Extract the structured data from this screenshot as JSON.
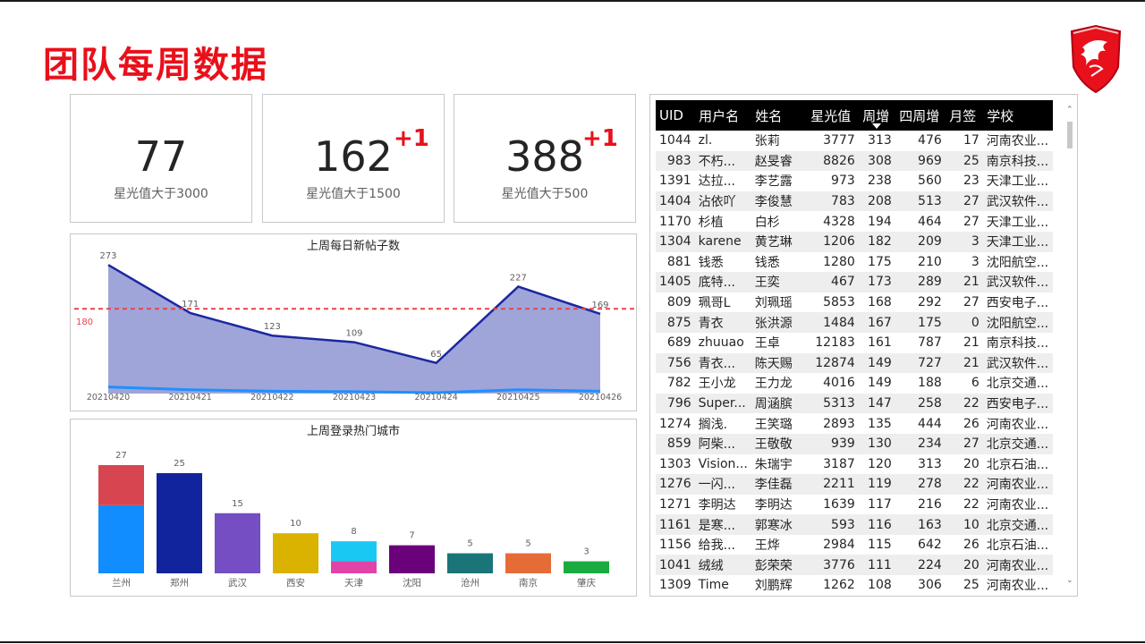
{
  "page_title": "团队每周数据",
  "colors": {
    "accent": "#e8101b",
    "area_fill": "#9fa5d8",
    "area_line": "#1b27a0",
    "ref_line": "#e8434d",
    "lower_line": "#1e90ff"
  },
  "kpis": [
    {
      "value": "77",
      "delta": "",
      "caption": "星光值大于3000"
    },
    {
      "value": "162",
      "delta": "+1",
      "caption": "星光值大于1500"
    },
    {
      "value": "388",
      "delta": "+1",
      "caption": "星光值大于500"
    }
  ],
  "chart_data": [
    {
      "type": "area",
      "title": "上周每日新帖子数",
      "x": [
        "20210420",
        "20210421",
        "20210422",
        "20210423",
        "20210424",
        "20210425",
        "20210426"
      ],
      "series": [
        {
          "values": [
            273,
            171,
            123,
            109,
            65,
            227,
            169
          ]
        },
        {
          "values": [
            14,
            8,
            5,
            4,
            2,
            8,
            5
          ]
        }
      ],
      "reference_line": {
        "value": 180,
        "label": "180"
      },
      "ylim": [
        0,
        300
      ]
    },
    {
      "type": "bar",
      "title": "上周登录热门城市",
      "categories": [
        "兰州",
        "郑州",
        "武汉",
        "西安",
        "天津",
        "沈阳",
        "沧州",
        "南京",
        "肇庆"
      ],
      "values": [
        27,
        25,
        15,
        10,
        8,
        7,
        5,
        5,
        3
      ],
      "stack_split": [
        10,
        0,
        0,
        0,
        5,
        0,
        0,
        0,
        0
      ],
      "colors_bottom": [
        "#118dff",
        "#12239e",
        "#744ec2",
        "#d9b300",
        "#e044a7",
        "#6b007b",
        "#1b7478",
        "#e66c37",
        "#1aab40"
      ],
      "colors_top": [
        "#d64550",
        "#12239e",
        "#744ec2",
        "#d9b300",
        "#1ac8f4",
        "#6b007b",
        "#1b7478",
        "#e66c37",
        "#1aab40"
      ],
      "ylim": [
        0,
        30
      ]
    }
  ],
  "table": {
    "columns": [
      "UID",
      "用户名",
      "姓名",
      "星光值",
      "周增",
      "四周增",
      "月签",
      "学校"
    ],
    "sorted_column": "周增",
    "rows": [
      [
        "1044",
        "zl.",
        "张莉",
        "3777",
        "313",
        "476",
        "17",
        "河南农业..."
      ],
      [
        "983",
        "不朽...",
        "赵旻睿",
        "8826",
        "308",
        "969",
        "25",
        "南京科技..."
      ],
      [
        "1391",
        "达拉...",
        "李艺露",
        "973",
        "238",
        "560",
        "23",
        "天津工业..."
      ],
      [
        "1404",
        "沾依吖",
        "李俊慧",
        "783",
        "208",
        "513",
        "27",
        "武汉软件..."
      ],
      [
        "1170",
        "杉植",
        "白杉",
        "4328",
        "194",
        "464",
        "27",
        "天津工业..."
      ],
      [
        "1304",
        "karene",
        "黄艺琳",
        "1206",
        "182",
        "209",
        "3",
        "天津工业..."
      ],
      [
        "881",
        "钱悉",
        "钱悉",
        "1280",
        "175",
        "210",
        "3",
        "沈阳航空..."
      ],
      [
        "1405",
        "底特...",
        "王奕",
        "467",
        "173",
        "289",
        "21",
        "武汉软件..."
      ],
      [
        "809",
        "珮哥L",
        "刘珮瑶",
        "5853",
        "168",
        "292",
        "27",
        "西安电子..."
      ],
      [
        "875",
        "青衣",
        "张洪源",
        "1484",
        "167",
        "175",
        "0",
        "沈阳航空..."
      ],
      [
        "689",
        "zhuuao",
        "王卓",
        "12183",
        "161",
        "787",
        "21",
        "南京科技..."
      ],
      [
        "756",
        "青衣...",
        "陈天赐",
        "12874",
        "149",
        "727",
        "21",
        "武汉软件..."
      ],
      [
        "782",
        "王小龙",
        "王力龙",
        "4016",
        "149",
        "188",
        "6",
        "北京交通..."
      ],
      [
        "796",
        "Super...",
        "周涵膑",
        "5313",
        "147",
        "258",
        "22",
        "西安电子..."
      ],
      [
        "1274",
        "搁浅.",
        "王笑璐",
        "2893",
        "135",
        "444",
        "26",
        "河南农业..."
      ],
      [
        "859",
        "阿柴...",
        "王敬敬",
        "939",
        "130",
        "234",
        "27",
        "北京交通..."
      ],
      [
        "1303",
        "Vision...",
        "朱瑞宇",
        "3187",
        "120",
        "313",
        "20",
        "北京石油..."
      ],
      [
        "1276",
        "一闪...",
        "李佳磊",
        "2211",
        "119",
        "278",
        "22",
        "河南农业..."
      ],
      [
        "1271",
        "李明达",
        "李明达",
        "1639",
        "117",
        "216",
        "22",
        "河南农业..."
      ],
      [
        "1161",
        "是寒...",
        "郭寒冰",
        "593",
        "116",
        "163",
        "10",
        "北京交通..."
      ],
      [
        "1156",
        "给我...",
        "王烨",
        "2984",
        "115",
        "642",
        "26",
        "北京石油..."
      ],
      [
        "1041",
        "绒绒",
        "彭荣荣",
        "3776",
        "111",
        "224",
        "20",
        "河南农业..."
      ],
      [
        "1309",
        "Time",
        "刘鹏辉",
        "1262",
        "108",
        "306",
        "25",
        "河南农业..."
      ]
    ]
  }
}
